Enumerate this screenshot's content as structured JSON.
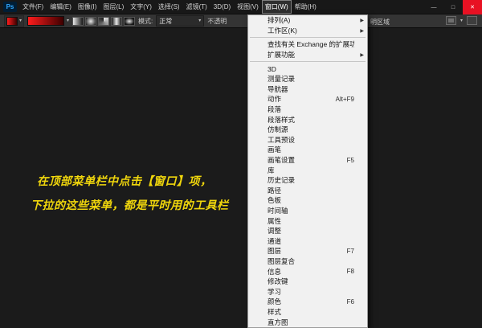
{
  "colors": {
    "close_button": "#e81123",
    "annotation_text": "#f0d60c",
    "gradient_swatch_start": "#ff1c1c",
    "gradient_swatch_end": "#3c0000",
    "menu_popup_bg": "#f1f1f1",
    "ui_dark_bg": "#1b1b1b"
  },
  "icons": {
    "dropdown_arrow": "▾",
    "submenu_arrow": "▶",
    "minimize": "—",
    "maximize": "□",
    "close": "✕"
  },
  "titlebar": {
    "logo": "Ps",
    "menus": [
      {
        "label": "文件(F)"
      },
      {
        "label": "编辑(E)"
      },
      {
        "label": "图像(I)"
      },
      {
        "label": "图层(L)"
      },
      {
        "label": "文字(Y)"
      },
      {
        "label": "选择(S)"
      },
      {
        "label": "滤镜(T)"
      },
      {
        "label": "3D(D)"
      },
      {
        "label": "视图(V)"
      },
      {
        "label": "窗口(W)",
        "active": true
      },
      {
        "label": "帮助(H)"
      }
    ]
  },
  "options_bar": {
    "mode_label": "模式:",
    "mode_value": "正常",
    "opacity_label": "不透明",
    "transparency_label": "明区域",
    "gradient_types": [
      {
        "name": "linear-gradient"
      },
      {
        "name": "radial-gradient"
      },
      {
        "name": "angle-gradient"
      },
      {
        "name": "reflected-gradient"
      },
      {
        "name": "diamond-gradient"
      }
    ]
  },
  "window_menu": {
    "items": [
      {
        "label": "排列(A)",
        "submenu": true
      },
      {
        "label": "工作区(K)",
        "submenu": true
      },
      {
        "type": "separator"
      },
      {
        "label": "查找有关 Exchange 的扩展功能..."
      },
      {
        "label": "扩展功能",
        "submenu": true
      },
      {
        "type": "separator"
      },
      {
        "label": "3D"
      },
      {
        "label": "测量记录"
      },
      {
        "label": "导航器"
      },
      {
        "label": "动作",
        "shortcut": "Alt+F9"
      },
      {
        "label": "段落"
      },
      {
        "label": "段落样式"
      },
      {
        "label": "仿制源"
      },
      {
        "label": "工具预设"
      },
      {
        "label": "画笔"
      },
      {
        "label": "画笔设置",
        "shortcut": "F5"
      },
      {
        "label": "库"
      },
      {
        "label": "历史记录"
      },
      {
        "label": "路径"
      },
      {
        "label": "色板"
      },
      {
        "label": "时间轴"
      },
      {
        "label": "属性"
      },
      {
        "label": "调整"
      },
      {
        "label": "通道"
      },
      {
        "label": "图层",
        "shortcut": "F7"
      },
      {
        "label": "图层复合"
      },
      {
        "label": "信息",
        "shortcut": "F8"
      },
      {
        "label": "修改键"
      },
      {
        "label": "学习"
      },
      {
        "label": "颜色",
        "shortcut": "F6"
      },
      {
        "label": "样式"
      },
      {
        "label": "直方图"
      }
    ]
  },
  "canvas": {
    "annotation_line1": "在顶部菜单栏中点击【窗口】项，",
    "annotation_line2": "下拉的这些菜单，都是平时用的工具栏"
  }
}
